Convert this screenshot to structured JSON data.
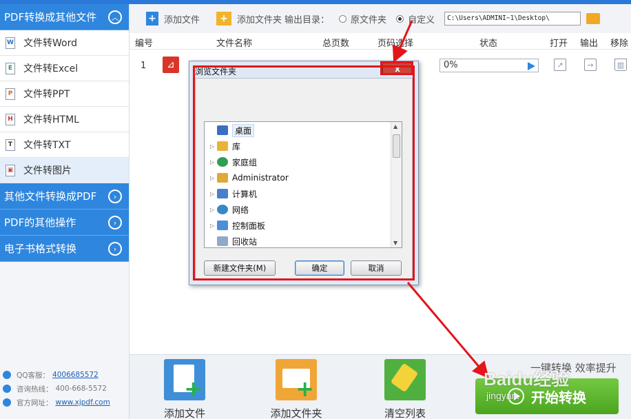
{
  "sidebar": {
    "groups": [
      {
        "label": "PDF转换成其他文件"
      },
      {
        "label": "其他文件转换成PDF"
      },
      {
        "label": "PDF的其他操作"
      },
      {
        "label": "电子书格式转换"
      }
    ],
    "items": [
      {
        "label": "文件转Word",
        "letter": "W"
      },
      {
        "label": "文件转Excel",
        "letter": "E"
      },
      {
        "label": "文件转PPT",
        "letter": "P"
      },
      {
        "label": "文件转HTML",
        "letter": "H"
      },
      {
        "label": "文件转TXT",
        "letter": "T"
      },
      {
        "label": "文件转图片",
        "letter": "▣"
      }
    ],
    "footer": {
      "qq_label": "QQ客服：",
      "qq_value": "4006685572",
      "hotline_label": "咨询热线：",
      "hotline_value": "400-668-5572",
      "site_label": "官方网址：",
      "site_value": "www.xjpdf.com"
    }
  },
  "toolbar": {
    "add_file": "添加文件",
    "add_folder": "添加文件夹",
    "output_dir_label": "输出目录：",
    "option_original": "原文件夹",
    "option_custom": "自定义",
    "output_path": "C:\\Users\\ADMINI~1\\Desktop\\"
  },
  "table": {
    "headers": {
      "index": "编号",
      "name": "文件名称",
      "pages": "总页数",
      "page_select": "页码选择",
      "status": "状态",
      "open": "打开",
      "output": "输出",
      "remove": "移除"
    },
    "rows": [
      {
        "index": "1",
        "progress": "0%"
      }
    ]
  },
  "dialog": {
    "title": "浏览文件夹",
    "close": "x",
    "tree": [
      {
        "label": "桌面",
        "icon": "desktop-icon",
        "color": "#3a6fc2"
      },
      {
        "label": "库",
        "icon": "library-icon",
        "color": "#e7b43a"
      },
      {
        "label": "家庭组",
        "icon": "homegroup-icon",
        "color": "#2f9e55"
      },
      {
        "label": "Administrator",
        "icon": "user-folder-icon",
        "color": "#e0a838"
      },
      {
        "label": "计算机",
        "icon": "computer-icon",
        "color": "#4a7fc9"
      },
      {
        "label": "网络",
        "icon": "network-icon",
        "color": "#3b86c4"
      },
      {
        "label": "控制面板",
        "icon": "control-panel-icon",
        "color": "#4c8fd6"
      },
      {
        "label": "回收站",
        "icon": "recycle-bin-icon",
        "color": "#8fa9c7"
      }
    ],
    "new_folder": "新建文件夹(M)",
    "ok": "确定",
    "cancel": "取消"
  },
  "bottom": {
    "add_file": "添加文件",
    "add_folder": "添加文件夹",
    "clear_list": "清空列表",
    "slogan": "一键转换  效率提升",
    "start": "开始转换"
  },
  "watermark": {
    "text": "Baidu经验",
    "sub": "jingyan."
  },
  "colors": {
    "accent": "#2e86de",
    "start": "#5cb531",
    "annotation": "#e3141a"
  }
}
